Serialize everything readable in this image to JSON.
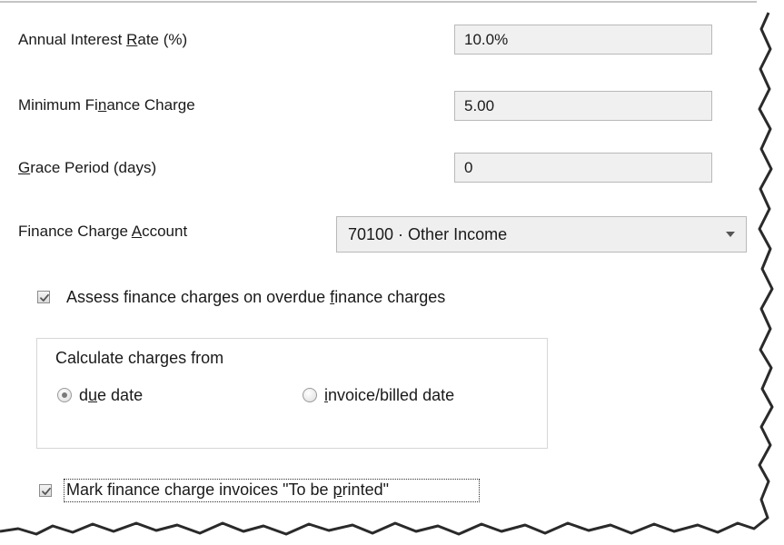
{
  "fields": {
    "annual_interest_rate": {
      "label_pre": "Annual Interest ",
      "label_key": "R",
      "label_post": "ate (%)",
      "value": "10.0%"
    },
    "minimum_finance_charge": {
      "label_pre": "Minimum Fi",
      "label_key": "n",
      "label_post": "ance Charge",
      "value": "5.00"
    },
    "grace_period": {
      "label_pre": "",
      "label_key": "G",
      "label_post": "race Period (days)",
      "value": "0"
    },
    "finance_charge_account": {
      "label_pre": "Finance Charge ",
      "label_key": "A",
      "label_post": "ccount",
      "value": "70100 · Other Income"
    }
  },
  "checkboxes": {
    "assess_overdue": {
      "label_pre": "Assess finance charges on overdue ",
      "label_key": "f",
      "label_post": "inance charges",
      "checked": true
    },
    "mark_to_be_printed": {
      "label_pre": "Mark finance charge invoices \"To be ",
      "label_key": "p",
      "label_post": "rinted\"",
      "checked": true
    }
  },
  "calculate_from": {
    "title": "Calculate charges from",
    "options": [
      {
        "label_pre": "d",
        "label_key": "u",
        "label_post": "e date",
        "selected": true
      },
      {
        "label_pre": "",
        "label_key": "i",
        "label_post": "nvoice/billed date",
        "selected": false
      }
    ]
  },
  "icons": {
    "dropdown": "chevron-down-icon",
    "check": "checkmark-icon"
  },
  "colors": {
    "field_background": "#f0f0f0",
    "field_border": "#b9b9b9",
    "text": "#1a1a1a"
  }
}
